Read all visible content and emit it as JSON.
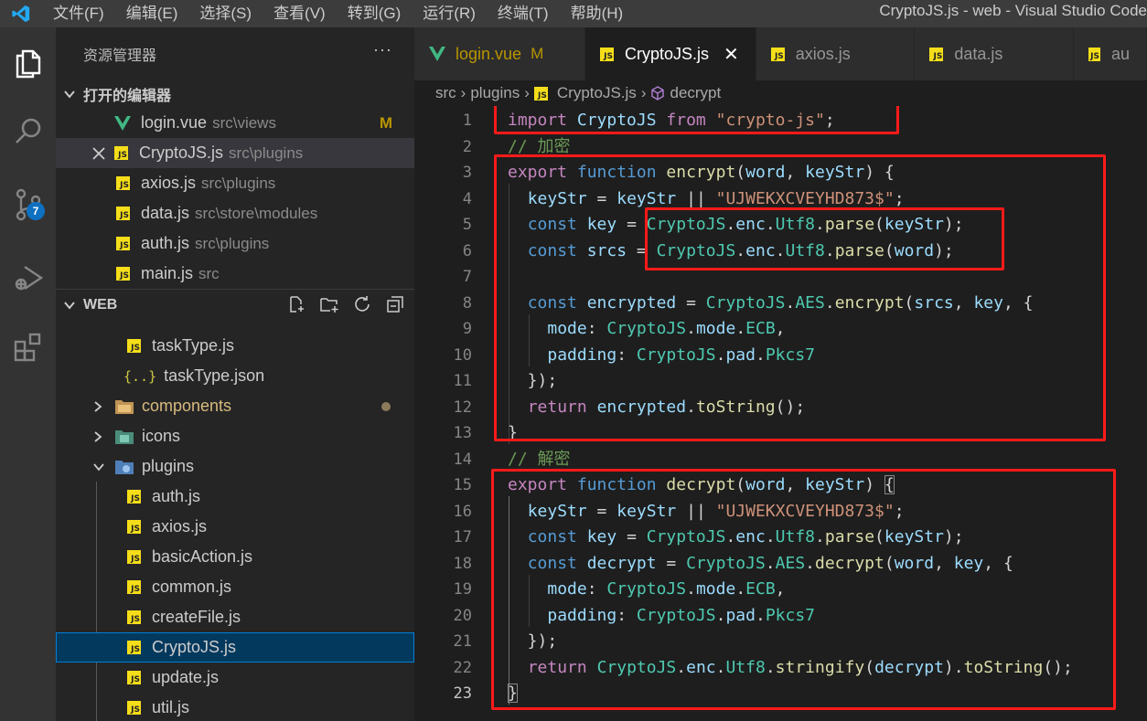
{
  "titlebar": {
    "menu": [
      "文件(F)",
      "编辑(E)",
      "选择(S)",
      "查看(V)",
      "转到(G)",
      "运行(R)",
      "终端(T)",
      "帮助(H)"
    ],
    "window_title": "CryptoJS.js - web - Visual Studio Code"
  },
  "activitybar": {
    "items": [
      "explorer-icon",
      "search-icon",
      "source-control-icon",
      "run-debug-icon",
      "extensions-icon"
    ],
    "source_control_badge": "7"
  },
  "sidebar": {
    "title": "资源管理器",
    "more": "···",
    "open_editors": {
      "title": "打开的编辑器",
      "items": [
        {
          "name": "login.vue",
          "path": "src\\views",
          "status": "M",
          "type": "vue"
        },
        {
          "name": "CryptoJS.js",
          "path": "src\\plugins",
          "status": "",
          "type": "js"
        },
        {
          "name": "axios.js",
          "path": "src\\plugins",
          "status": "",
          "type": "js"
        },
        {
          "name": "data.js",
          "path": "src\\store\\modules",
          "status": "",
          "type": "js"
        },
        {
          "name": "auth.js",
          "path": "src\\plugins",
          "status": "",
          "type": "js"
        },
        {
          "name": "main.js",
          "path": "src",
          "status": "",
          "type": "js"
        }
      ]
    },
    "workspace": {
      "title": "WEB",
      "tree": {
        "tasktype_js": "taskType.js",
        "tasktype_json": "taskType.json",
        "components": "components",
        "icons": "icons",
        "plugins": "plugins",
        "plugin_files": [
          "auth.js",
          "axios.js",
          "basicAction.js",
          "common.js",
          "createFile.js",
          "CryptoJS.js",
          "update.js",
          "util.js"
        ]
      }
    }
  },
  "tabs": [
    {
      "label": "login.vue",
      "status": "M",
      "type": "vue"
    },
    {
      "label": "CryptoJS.js",
      "status": "",
      "type": "js",
      "close": "✕"
    },
    {
      "label": "axios.js",
      "status": "",
      "type": "js"
    },
    {
      "label": "data.js",
      "status": "",
      "type": "js"
    },
    {
      "label": "au",
      "status": "",
      "type": "js"
    }
  ],
  "breadcrumb": {
    "parts": [
      "src",
      "plugins",
      "CryptoJS.js",
      "decrypt"
    ]
  },
  "editor": {
    "line_numbers": [
      "1",
      "2",
      "3",
      "4",
      "5",
      "6",
      "7",
      "8",
      "9",
      "10",
      "11",
      "12",
      "13",
      "14",
      "15",
      "16",
      "17",
      "18",
      "19",
      "20",
      "21",
      "22",
      "23"
    ]
  },
  "colors": {
    "editor_bg": "#1e1e1e",
    "sidebar_bg": "#252526",
    "activitybar_bg": "#333333",
    "highlight_box": "#ff1a1a",
    "accent": "#007fd4"
  }
}
